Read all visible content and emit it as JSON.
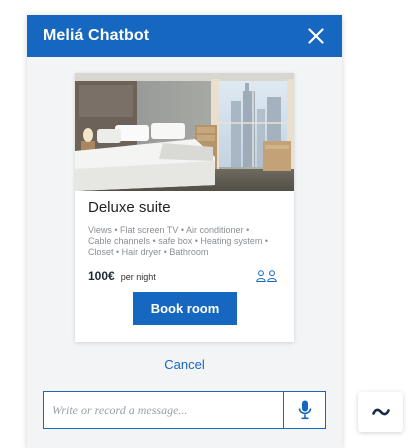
{
  "header": {
    "title": "Meliá Chatbot",
    "close_icon": "close-icon",
    "background": "#1667c0"
  },
  "room_card": {
    "image": "hotel-room-photo",
    "name": "Deluxe suite",
    "amenities": [
      "Views",
      "Flat screen TV",
      "Air conditioner",
      "Cable channels",
      "safe box",
      "Heating system",
      "Closet",
      "Hair dryer",
      "Bathroom"
    ],
    "price": "100€",
    "price_unit": "per night",
    "guests_icon": "two-guests-icon",
    "book_label": "Book room"
  },
  "cancel_label": "Cancel",
  "composer": {
    "placeholder": "Write or record a message...",
    "value": "",
    "mic_icon": "microphone-icon"
  },
  "minimize_icon": "tilde-icon",
  "accent_color": "#1667c0"
}
